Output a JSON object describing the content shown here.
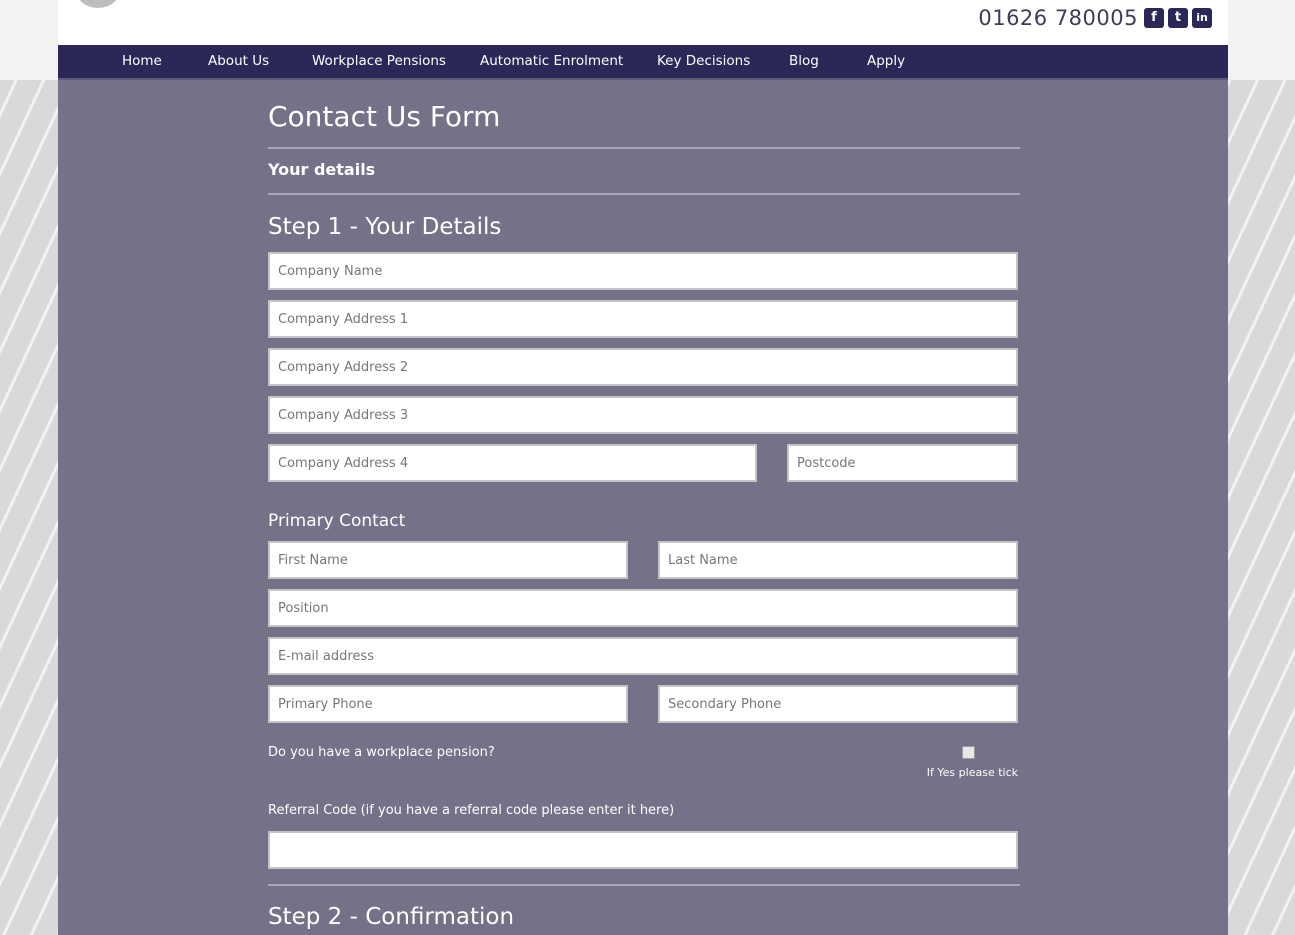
{
  "header": {
    "phone": "01626 780005",
    "social": [
      {
        "icon": "facebook-icon",
        "glyph": "f"
      },
      {
        "icon": "twitter-icon",
        "glyph": "t"
      },
      {
        "icon": "linkedin-icon",
        "glyph": "in"
      }
    ]
  },
  "nav": {
    "items": [
      "Home",
      "About Us",
      "Workplace Pensions",
      "Automatic Enrolment",
      "Key Decisions",
      "Blog",
      "Apply"
    ]
  },
  "form": {
    "title": "Contact Us Form",
    "section_label": "Your details",
    "step1_title": "Step 1 - Your Details",
    "fields": {
      "company_name": "Company Name",
      "company_address_1": "Company Address 1",
      "company_address_2": "Company Address 2",
      "company_address_3": "Company Address 3",
      "company_address_4": "Company Address 4",
      "postcode": "Postcode",
      "first_name": "First Name",
      "last_name": "Last Name",
      "position": "Position",
      "email": "E-mail address",
      "primary_phone": "Primary Phone",
      "secondary_phone": "Secondary Phone",
      "referral_code": ""
    },
    "primary_contact_title": "Primary Contact",
    "pension_question": "Do you have a workplace pension?",
    "pension_tick_note": "If Yes please tick",
    "referral_label": "Referral Code (if you have a referral code please enter it here)",
    "step2_title": "Step 2 - Confirmation"
  },
  "colors": {
    "nav_bg": "#2b2858",
    "main_bg": "#757189",
    "header_bg": "#ffffff"
  }
}
